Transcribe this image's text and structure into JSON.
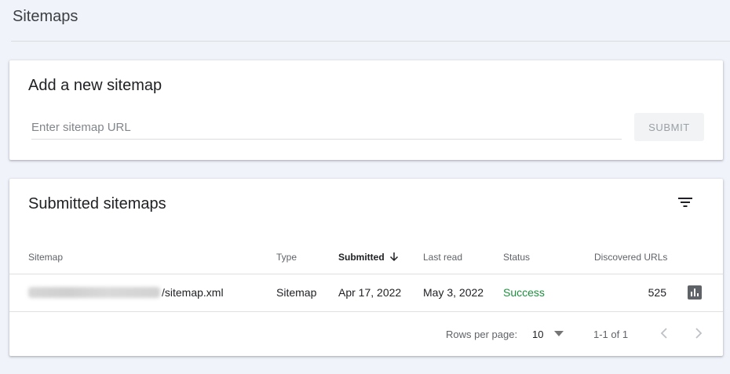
{
  "page": {
    "title": "Sitemaps"
  },
  "add_sitemap": {
    "heading": "Add a new sitemap",
    "input_placeholder": "Enter sitemap URL",
    "input_value": "",
    "submit_label": "SUBMIT"
  },
  "submitted": {
    "heading": "Submitted sitemaps",
    "columns": {
      "sitemap": "Sitemap",
      "type": "Type",
      "submitted": "Submitted",
      "last_read": "Last read",
      "status": "Status",
      "discovered": "Discovered URLs"
    },
    "rows": [
      {
        "sitemap_path": "/sitemap.xml",
        "type": "Sitemap",
        "submitted": "Apr 17, 2022",
        "last_read": "May 3, 2022",
        "status": "Success",
        "discovered": "525"
      }
    ],
    "footer": {
      "rows_per_page_label": "Rows per page:",
      "rows_per_page_value": "10",
      "range": "1-1 of 1"
    }
  },
  "colors": {
    "background": "#f1f3fb",
    "status_success": "#1e8e3e",
    "icon_gray": "#5f6368"
  },
  "icons": {
    "filter": "filter-icon",
    "sort": "arrow-down-icon",
    "report": "bar-chart-icon",
    "dropdown": "triangle-down-icon",
    "prev": "chevron-left-icon",
    "next": "chevron-right-icon"
  }
}
